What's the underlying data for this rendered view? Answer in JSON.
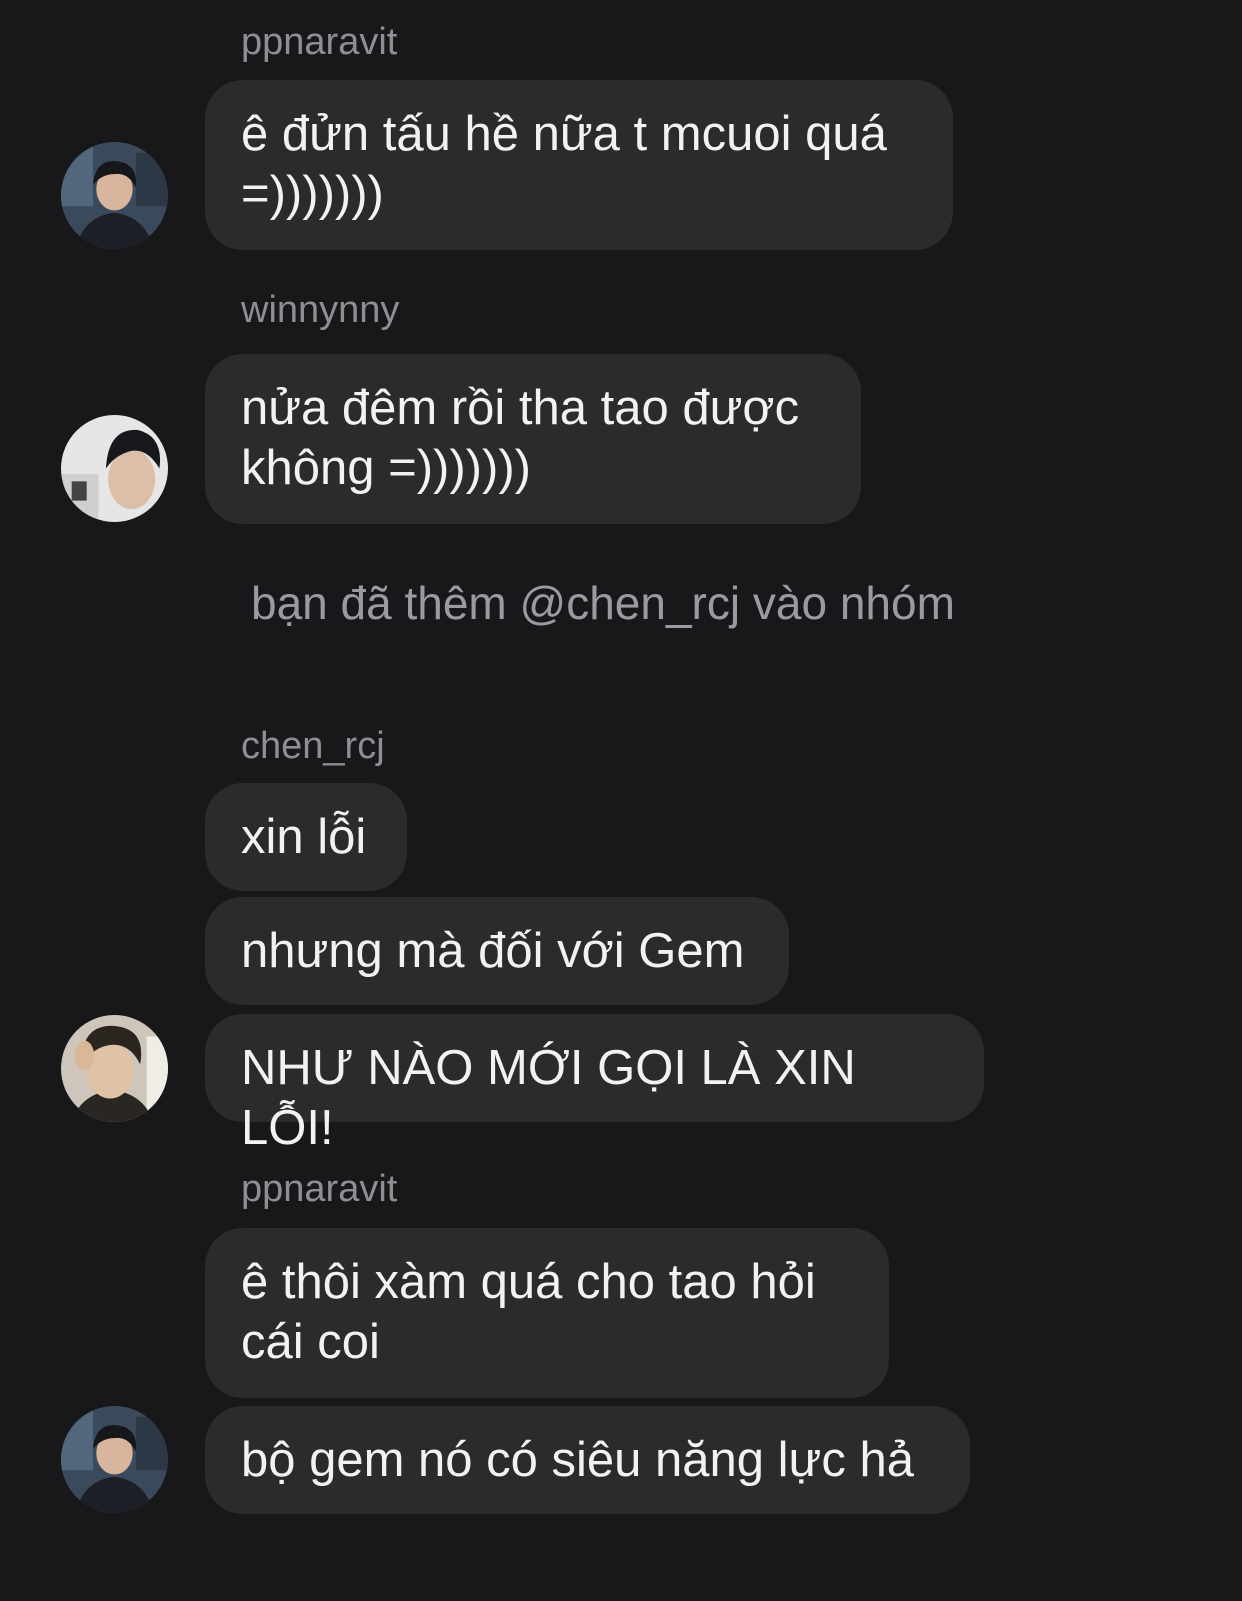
{
  "messages": [
    {
      "username": "ppnaravit",
      "text": "ê đửn tấu hề nữa t mcuoi quá\n=)))))))"
    },
    {
      "username": "winnynny",
      "text": "nửa đêm rồi tha tao được\nkhông =)))))))"
    },
    {
      "system": "bạn đã thêm @chen_rcj vào nhóm"
    },
    {
      "username": "chen_rcj",
      "lines": [
        "xin lỗi",
        "nhưng mà đối với Gem",
        "NHƯ NÀO MỚI GỌI LÀ XIN LỖI!"
      ]
    },
    {
      "username": "ppnaravit",
      "lines": [
        "ê thôi xàm quá cho tao hỏi\ncái coi",
        "bộ gem nó có siêu năng lực hả"
      ]
    }
  ],
  "avatars": [
    {
      "user": "ppnaravit",
      "icon": "profile-photo-icon"
    },
    {
      "user": "winnynny",
      "icon": "profile-photo-icon"
    },
    {
      "user": "chen_rcj",
      "icon": "profile-photo-icon"
    },
    {
      "user": "ppnaravit",
      "icon": "profile-photo-icon"
    }
  ],
  "colors": {
    "background": "#18181a",
    "bubble": "#2b2b2e",
    "text": "#f2f2f4",
    "username": "#8e8e93",
    "system_text": "#9a9aa0"
  }
}
